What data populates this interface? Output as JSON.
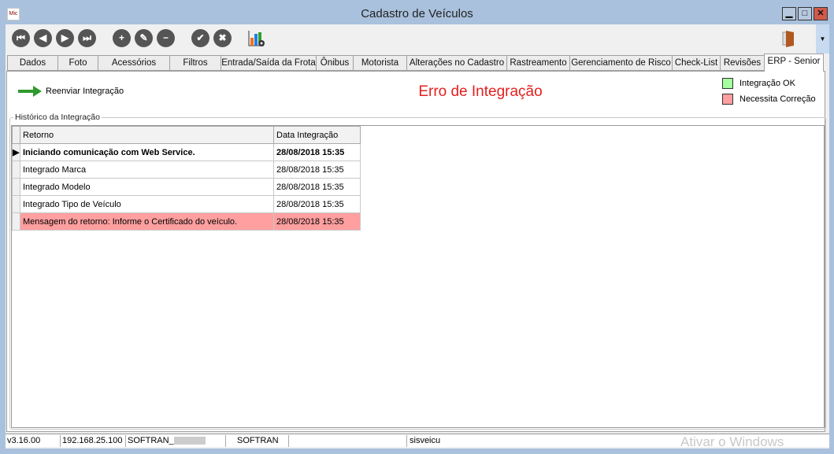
{
  "window": {
    "title": "Cadastro de Veículos",
    "app_icon_text": "Mic",
    "minimize": "▁",
    "maximize": "□",
    "close": "✕"
  },
  "toolbar": {
    "buttons": [
      {
        "name": "first-record",
        "glyph": "⏮"
      },
      {
        "name": "previous-record",
        "glyph": "◀"
      },
      {
        "name": "next-record",
        "glyph": "▶"
      },
      {
        "name": "last-record",
        "glyph": "⏭"
      },
      {
        "name": "add",
        "glyph": "+"
      },
      {
        "name": "edit",
        "glyph": "✎"
      },
      {
        "name": "delete",
        "glyph": "−"
      },
      {
        "name": "confirm",
        "glyph": "✔"
      },
      {
        "name": "cancel",
        "glyph": "✖"
      }
    ],
    "dropdown": "▼"
  },
  "tabs": [
    "Dados",
    "Foto",
    "Acessórios",
    "Filtros",
    "Entrada/Saída da Frota",
    "Ônibus",
    "Motorista",
    "Alterações no Cadastro",
    "Rastreamento",
    "Gerenciamento de Risco",
    "Check-List",
    "Revisões",
    "ERP - Senior"
  ],
  "active_tab": "ERP - Senior",
  "main": {
    "resend_label": "Reenviar Integração",
    "error_title": "Erro de Integração",
    "legend": [
      {
        "label": "Integração OK",
        "color": "#a5ff9f"
      },
      {
        "label": "Necessita Correção",
        "color": "#ff9f9f"
      }
    ],
    "group_label": "Histórico da Integração",
    "columns": [
      "Retorno",
      "Data Integração"
    ],
    "rows": [
      {
        "retorno": "Iniciando comunicação com Web Service.",
        "data": "28/08/2018 15:35"
      },
      {
        "retorno": "Integrado Marca",
        "data": "28/08/2018 15:35"
      },
      {
        "retorno": "Integrado Modelo",
        "data": "28/08/2018 15:35"
      },
      {
        "retorno": "Integrado Tipo de Veículo",
        "data": "28/08/2018 15:35"
      },
      {
        "retorno": "Mensagem do retorno: Informe o Certificado do veículo.",
        "data": "28/08/2018 15:35"
      }
    ]
  },
  "status": {
    "version": "v3.16.00",
    "ip": "192.168.25.100",
    "company": "SOFTRAN_",
    "db": "SOFTRAN",
    "empty": "",
    "user": "sisveicu"
  },
  "watermark": "Ativar o Windows"
}
